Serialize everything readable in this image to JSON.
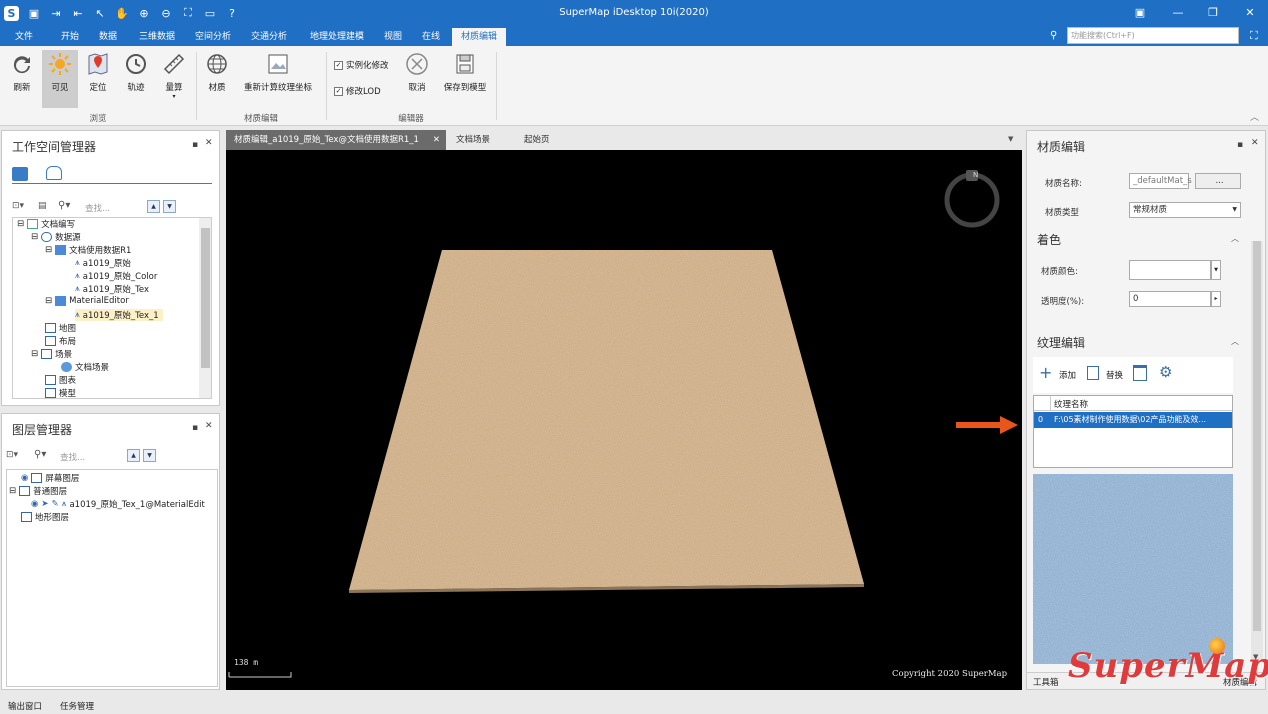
{
  "app": {
    "title": "SuperMap iDesktop 10i(2020)"
  },
  "menu": {
    "tabs": [
      "文件",
      "开始",
      "数据",
      "三维数据",
      "空间分析",
      "交通分析",
      "地理处理建模",
      "视图",
      "在线",
      "材质编辑"
    ],
    "search_placeholder": "功能搜索(Ctrl+F)"
  },
  "ribbon": {
    "buttons": [
      "刷新",
      "可见",
      "定位",
      "轨迹",
      "量算",
      "材质",
      "重新计算纹理坐标"
    ],
    "checks": [
      "实例化修改",
      "修改LOD"
    ],
    "cancel": "取消",
    "save": "保存到模型",
    "groups": [
      "浏览",
      "材质编辑",
      "编辑器"
    ]
  },
  "workspace": {
    "title": "工作空间管理器",
    "search_placeholder": "查找...",
    "tree": [
      "文档编写",
      "数据源",
      "文档使用数据R1",
      "a1019_原始",
      "a1019_原始_Color",
      "a1019_原始_Tex",
      "MaterialEditor",
      "a1019_原始_Tex_1",
      "地图",
      "布局",
      "场景",
      "文档场景",
      "图表",
      "模型"
    ]
  },
  "layers": {
    "title": "图层管理器",
    "search_placeholder": "查找...",
    "tree": [
      "屏幕图层",
      "普通图层",
      "a1019_原始_Tex_1@MaterialEdit",
      "地形图层"
    ]
  },
  "doc_tabs": [
    "材质编辑_a1019_原始_Tex@文档使用数据R1_1",
    "文档场景",
    "起始页"
  ],
  "viewport": {
    "scale": "138 m",
    "copyright": "Copyright 2020 SuperMap",
    "compass": "N"
  },
  "material": {
    "title": "材质编辑",
    "name_label": "材质名称:",
    "name_value": "_defaultMat_s",
    "browse": "...",
    "type_label": "材质类型",
    "type_value": "常规材质",
    "color_section": "着色",
    "color_label": "材质颜色:",
    "opacity_label": "透明度(%):",
    "opacity_value": "0",
    "texture_section": "纹理编辑",
    "add": "添加",
    "replace": "替换",
    "col_header": "纹理名称",
    "row_index": "0",
    "row_value": "F:\\05素材制作使用数据\\02产品功能及效..."
  },
  "bottom_tabs": [
    "工具箱",
    "材质编辑"
  ],
  "status": [
    "输出窗口",
    "任务管理"
  ],
  "colors": {
    "accent": "#1f6fc5",
    "arrow": "#e8561c",
    "selected_row": "#1f6fc5"
  },
  "watermark": "SuperMap"
}
